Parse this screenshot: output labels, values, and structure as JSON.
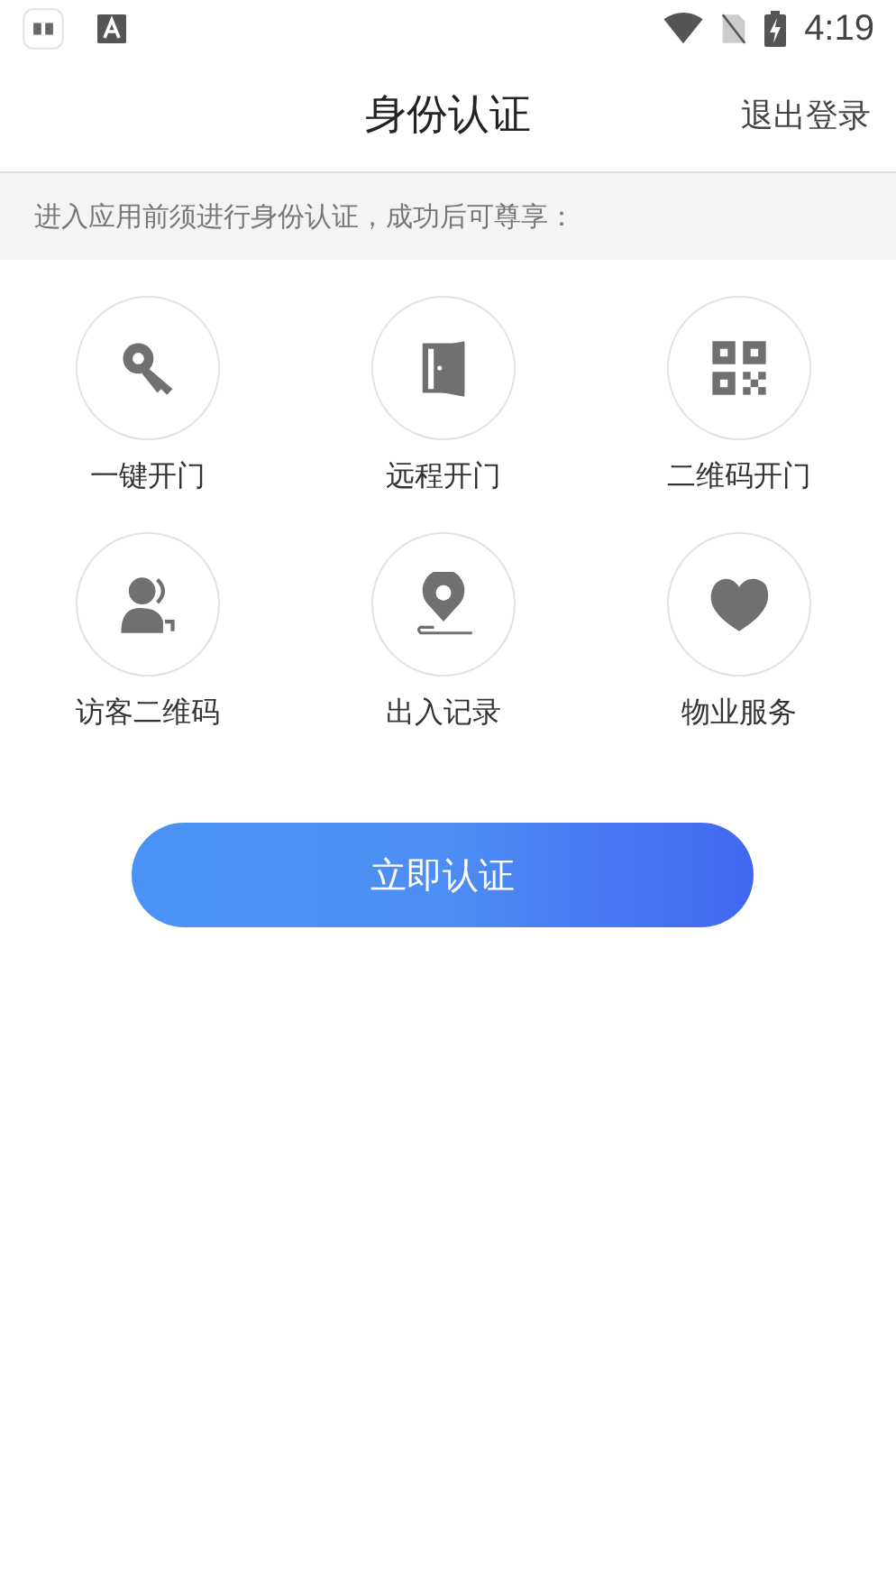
{
  "status_bar": {
    "time": "4:19"
  },
  "header": {
    "title": "身份认证",
    "action": "退出登录"
  },
  "notice": "进入应用前须进行身份认证，成功后可尊享：",
  "features": [
    {
      "kind": "key",
      "label": "一键开门"
    },
    {
      "kind": "door",
      "label": "远程开门"
    },
    {
      "kind": "qr",
      "label": "二维码开门"
    },
    {
      "kind": "visitor",
      "label": "访客二维码"
    },
    {
      "kind": "location",
      "label": "出入记录"
    },
    {
      "kind": "heart",
      "label": "物业服务"
    }
  ],
  "button": "立即认证"
}
